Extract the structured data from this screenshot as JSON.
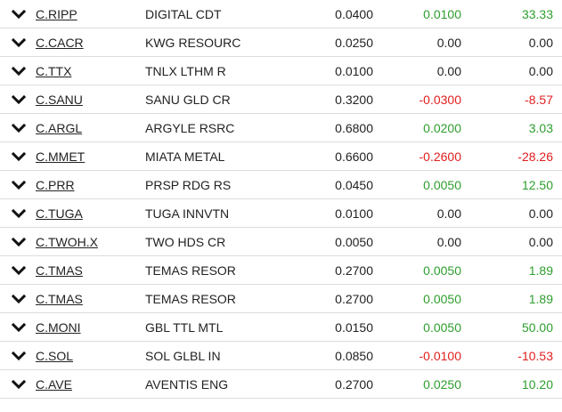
{
  "colors": {
    "positive": "#2e9e2e",
    "negative": "#e02020",
    "neutral": "#222222",
    "divider": "#dcdcdc"
  },
  "row_icon": "chevron-down-icon",
  "rows": [
    {
      "symbol": "C.RIPP",
      "name": "DIGITAL CDT",
      "last": "0.0400",
      "change": "0.0100",
      "pct": "33.33",
      "dir": "up"
    },
    {
      "symbol": "C.CACR",
      "name": "KWG RESOURC",
      "last": "0.0250",
      "change": "0.00",
      "pct": "0.00",
      "dir": "flat"
    },
    {
      "symbol": "C.TTX",
      "name": "TNLX LTHM R",
      "last": "0.0100",
      "change": "0.00",
      "pct": "0.00",
      "dir": "flat"
    },
    {
      "symbol": "C.SANU",
      "name": "SANU GLD CR",
      "last": "0.3200",
      "change": "-0.0300",
      "pct": "-8.57",
      "dir": "down"
    },
    {
      "symbol": "C.ARGL",
      "name": "ARGYLE RSRC",
      "last": "0.6800",
      "change": "0.0200",
      "pct": "3.03",
      "dir": "up"
    },
    {
      "symbol": "C.MMET",
      "name": "MIATA METAL",
      "last": "0.6600",
      "change": "-0.2600",
      "pct": "-28.26",
      "dir": "down"
    },
    {
      "symbol": "C.PRR",
      "name": "PRSP RDG RS",
      "last": "0.0450",
      "change": "0.0050",
      "pct": "12.50",
      "dir": "up"
    },
    {
      "symbol": "C.TUGA",
      "name": "TUGA INNVTN",
      "last": "0.0100",
      "change": "0.00",
      "pct": "0.00",
      "dir": "flat"
    },
    {
      "symbol": "C.TWOH.X",
      "name": "TWO HDS CR",
      "last": "0.0050",
      "change": "0.00",
      "pct": "0.00",
      "dir": "flat"
    },
    {
      "symbol": "C.TMAS",
      "name": "TEMAS RESOR",
      "last": "0.2700",
      "change": "0.0050",
      "pct": "1.89",
      "dir": "up"
    },
    {
      "symbol": "C.TMAS",
      "name": "TEMAS RESOR",
      "last": "0.2700",
      "change": "0.0050",
      "pct": "1.89",
      "dir": "up"
    },
    {
      "symbol": "C.MONI",
      "name": "GBL TTL MTL",
      "last": "0.0150",
      "change": "0.0050",
      "pct": "50.00",
      "dir": "up"
    },
    {
      "symbol": "C.SOL",
      "name": "SOL GLBL IN",
      "last": "0.0850",
      "change": "-0.0100",
      "pct": "-10.53",
      "dir": "down"
    },
    {
      "symbol": "C.AVE",
      "name": "AVENTIS ENG",
      "last": "0.2700",
      "change": "0.0250",
      "pct": "10.20",
      "dir": "up"
    }
  ]
}
